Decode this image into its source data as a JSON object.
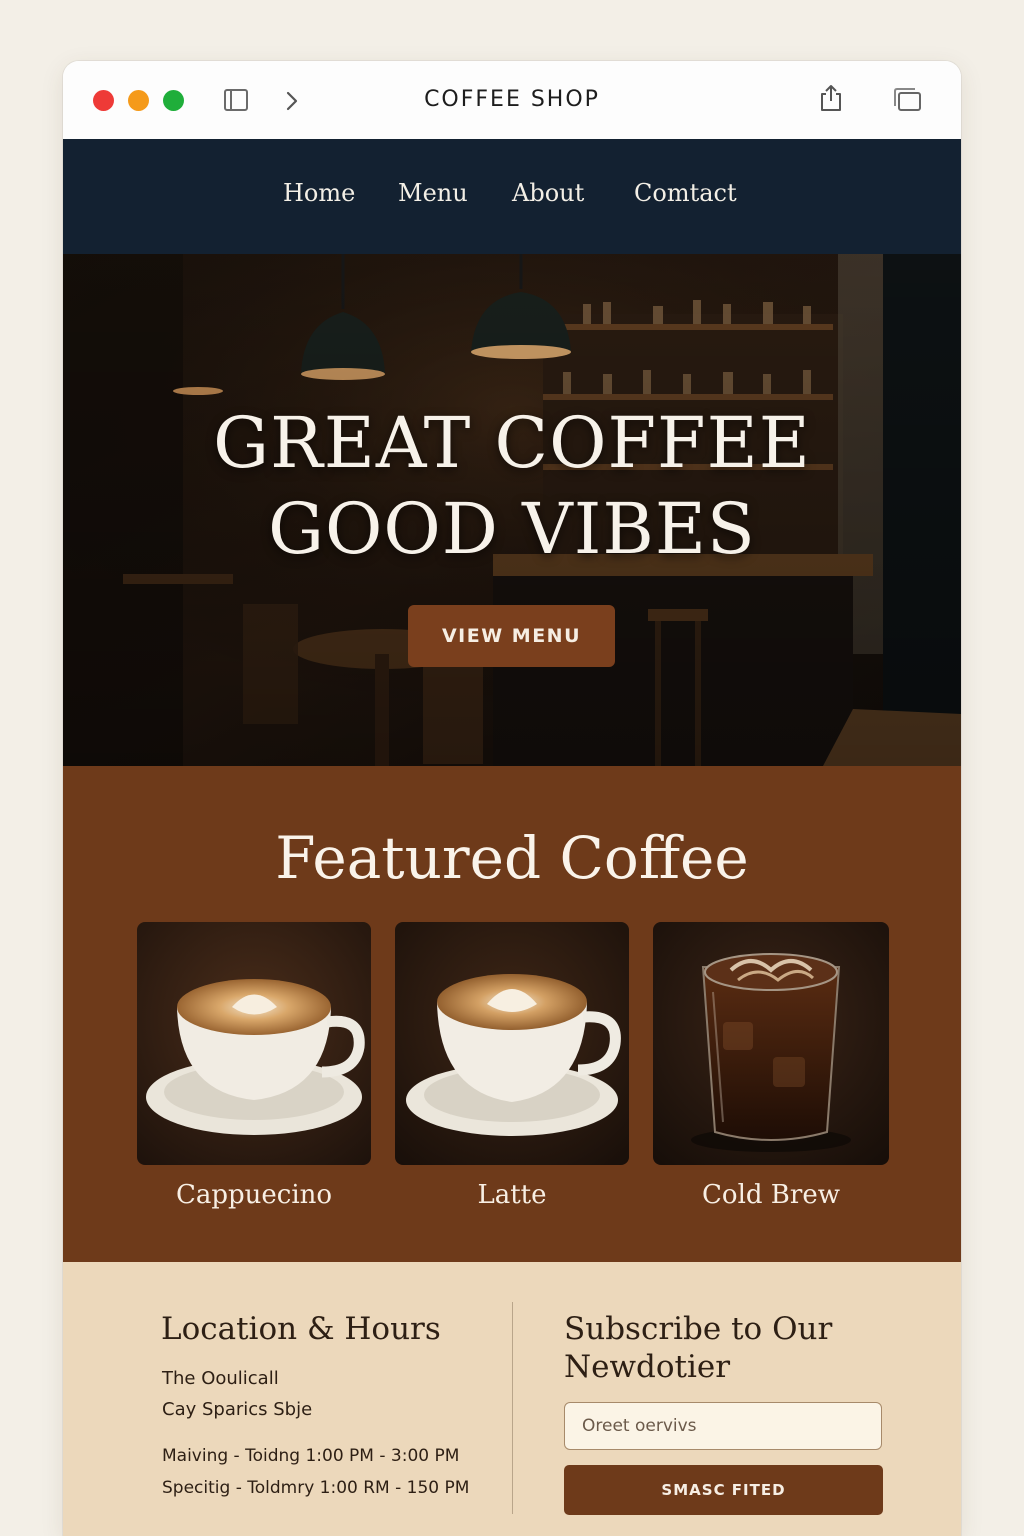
{
  "window": {
    "title": "COFFEE SHOP"
  },
  "toolbar": {
    "icons": [
      "close-dot",
      "minimize-dot",
      "zoom-dot",
      "sidebar-icon",
      "forward-chevron-icon",
      "share-icon",
      "tabs-icon"
    ]
  },
  "nav": {
    "items": [
      {
        "label": "Home"
      },
      {
        "label": "Menu"
      },
      {
        "label": "About"
      },
      {
        "label": "Comtact"
      }
    ]
  },
  "hero": {
    "line1": "GREAT COFFEE",
    "line2": "GOOD VIBES",
    "cta_label": "VIEW MENU"
  },
  "featured": {
    "title": "Featured Coffee",
    "items": [
      {
        "name": "Cappuecino"
      },
      {
        "name": "Latte"
      },
      {
        "name": "Cold Brew"
      }
    ]
  },
  "location": {
    "heading": "Location & Hours",
    "address_line1": "The Ooulicall",
    "address_line2": "Cay Sparics Sbje",
    "hours_line1": "Maiving - Toidng 1:00 PM - 3:00 PM",
    "hours_line2": "Specitig - Toldmry 1:00 RM - 150 PM"
  },
  "subscribe": {
    "heading_line1": "Subscribe to Our",
    "heading_line2": "Newdotier",
    "email_placeholder": "Oreet oervivs",
    "submit_label": "SMASC FITED"
  },
  "colors": {
    "nav_bg": "#132131",
    "accent_brown": "#6e3a1a",
    "cta_brown": "#7a3f1d",
    "cream": "#ecd8bb"
  }
}
